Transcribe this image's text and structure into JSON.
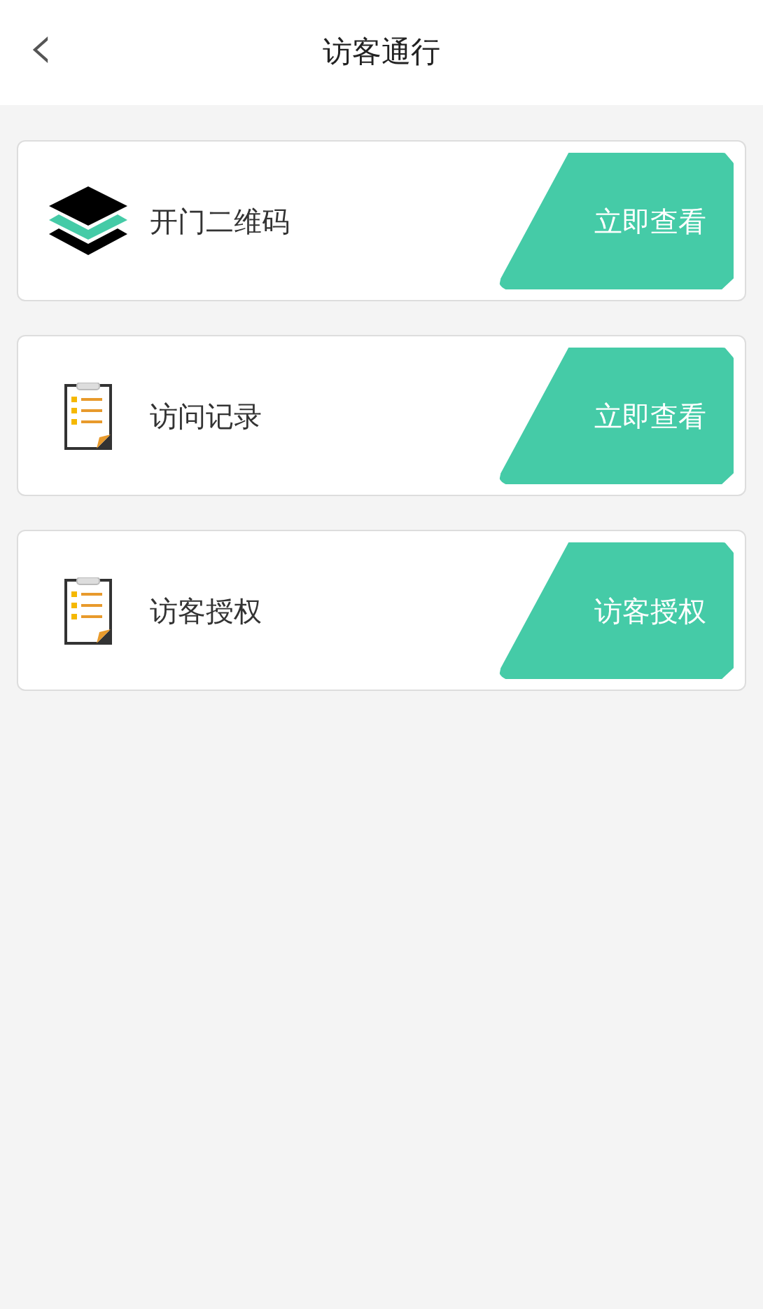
{
  "header": {
    "back": "‹",
    "title": "访客通行"
  },
  "items": [
    {
      "kind": "layers",
      "label": "开门二维码",
      "action": "立即查看"
    },
    {
      "kind": "clipboard",
      "label": "访问记录",
      "action": "立即查看"
    },
    {
      "kind": "clipboard",
      "label": "访客授权",
      "action": "访客授权"
    }
  ]
}
